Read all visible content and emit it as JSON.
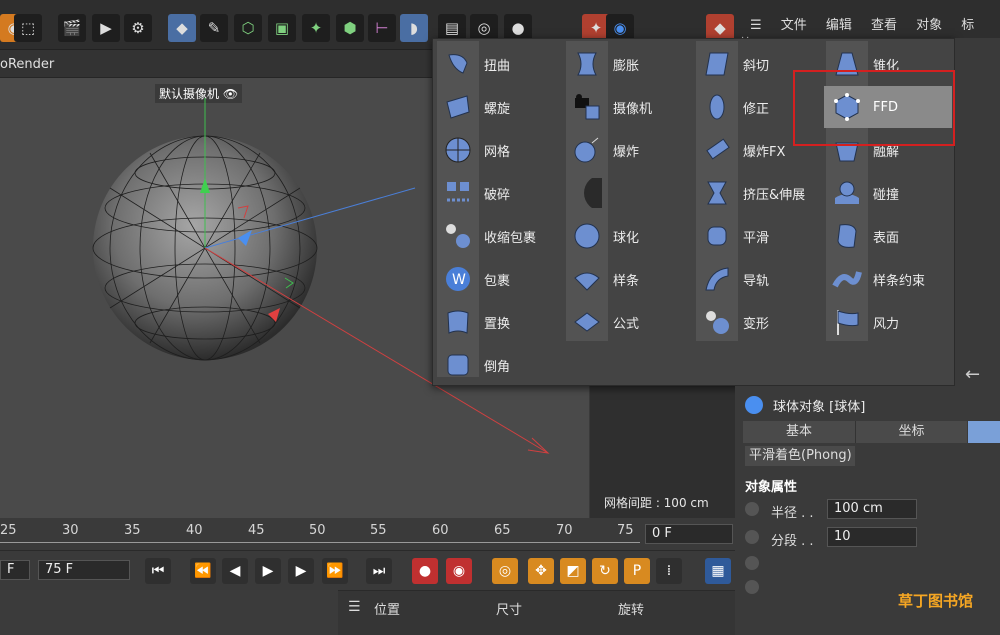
{
  "viewport": {
    "title": "oRender",
    "camera_label": "默认摄像机",
    "grid_spacing": "网格间距 : 100 cm"
  },
  "top_menu": [
    "文件",
    "编辑",
    "查看",
    "对象",
    "标签"
  ],
  "deformer_menu": {
    "columns": [
      [
        {
          "label": "扭曲",
          "icon": "twist-icon"
        },
        {
          "label": "螺旋",
          "icon": "spiral-icon"
        },
        {
          "label": "网格",
          "icon": "mesh-icon"
        },
        {
          "label": "破碎",
          "icon": "shatter-icon"
        },
        {
          "label": "收缩包裹",
          "icon": "shrinkwrap-icon"
        },
        {
          "label": "包裹",
          "icon": "wrap-icon"
        },
        {
          "label": "置换",
          "icon": "displacer-icon"
        },
        {
          "label": "倒角",
          "icon": "bevel-icon"
        }
      ],
      [
        {
          "label": "膨胀",
          "icon": "bulge-icon"
        },
        {
          "label": "摄像机",
          "icon": "camera-deformer-icon"
        },
        {
          "label": "爆炸",
          "icon": "explosion-icon"
        },
        {
          "label": "",
          "icon": "melt-icon"
        },
        {
          "label": "球化",
          "icon": "spherify-icon"
        },
        {
          "label": "样条",
          "icon": "spline-deformer-icon"
        },
        {
          "label": "公式",
          "icon": "formula-icon"
        }
      ],
      [
        {
          "label": "斜切",
          "icon": "shear-icon"
        },
        {
          "label": "修正",
          "icon": "correction-icon"
        },
        {
          "label": "爆炸FX",
          "icon": "explosionfx-icon"
        },
        {
          "label": "挤压&伸展",
          "icon": "squash-stretch-icon"
        },
        {
          "label": "平滑",
          "icon": "smoothing-icon"
        },
        {
          "label": "导轨",
          "icon": "spline-rail-icon"
        },
        {
          "label": "变形",
          "icon": "morph-icon"
        }
      ],
      [
        {
          "label": "锥化",
          "icon": "taper-icon"
        },
        {
          "label": "FFD",
          "icon": "ffd-icon"
        },
        {
          "label": "融解",
          "icon": "melt-deformer-icon"
        },
        {
          "label": "碰撞",
          "icon": "collision-icon"
        },
        {
          "label": "表面",
          "icon": "surface-icon"
        },
        {
          "label": "样条约束",
          "icon": "spline-wrap-icon"
        },
        {
          "label": "风力",
          "icon": "wind-icon"
        }
      ]
    ],
    "selected": "FFD"
  },
  "attributes": {
    "object_title": "球体对象 [球体]",
    "tabs": [
      "基本",
      "坐标"
    ],
    "phong": "平滑着色(Phong)",
    "section": "对象属性",
    "radius_label": "半径 . .",
    "radius_value": "100 cm",
    "segments_label": "分段 . .",
    "segments_value": "10"
  },
  "timeline": {
    "ticks": [
      "25",
      "30",
      "35",
      "40",
      "45",
      "50",
      "55",
      "60",
      "65",
      "70",
      "75"
    ],
    "frame_field": "0 F",
    "end_frame": "75 F",
    "start_frame": "F"
  },
  "coords": {
    "position": "位置",
    "size": "尺寸",
    "rotation": "旋转"
  },
  "watermark": "草丁图书馆",
  "colors": {
    "accent": "#4a6ea3",
    "selection": "#8a8a8a",
    "highlight_box": "#d42020",
    "icon_fill": "#6d8fd0"
  }
}
